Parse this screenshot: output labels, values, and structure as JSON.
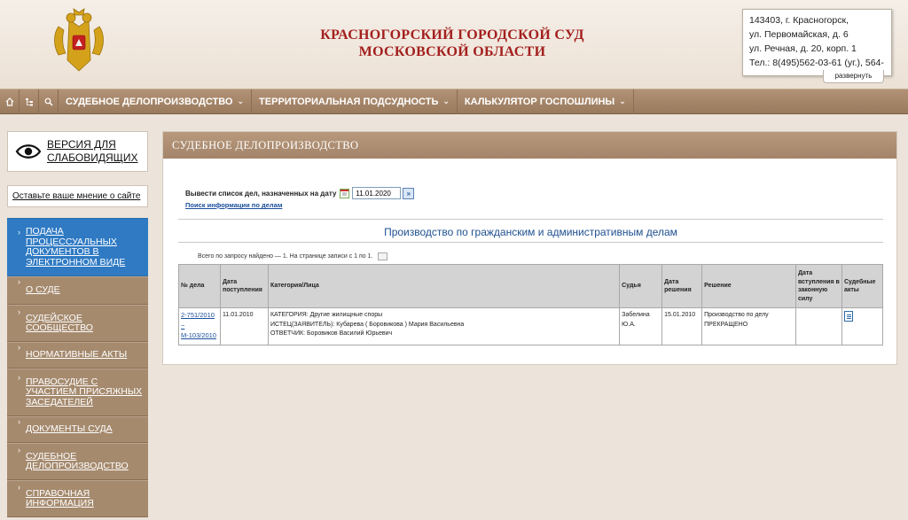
{
  "header": {
    "title_line1": "КРАСНОГОРСКИЙ ГОРОДСКОЙ СУД",
    "title_line2": "МОСКОВСКОЙ ОБЛАСТИ",
    "address": [
      "143403, г. Красногорск,",
      "ул. Первомайская, д. 6",
      "ул. Речная, д. 20, корп. 1",
      "Тел.: 8(495)562-03-61 (уг.), 564-"
    ],
    "expand_label": "развернуть"
  },
  "nav": {
    "icons": [
      "home-icon",
      "sitemap-icon",
      "search-icon"
    ],
    "items": [
      {
        "label": "СУДЕБНОЕ ДЕЛОПРОИЗВОДСТВО"
      },
      {
        "label": "ТЕРРИТОРИАЛЬНАЯ ПОДСУДНОСТЬ"
      },
      {
        "label": "КАЛЬКУЛЯТОР ГОСПОШЛИНЫ"
      }
    ],
    "chevron": "⌄"
  },
  "sidebar": {
    "vision_label": "ВЕРСИЯ ДЛЯ СЛАБОВИДЯЩИХ",
    "feedback_label": "Оставьте ваше мнение о сайте",
    "items": [
      {
        "label": "ПОДАЧА ПРОЦЕССУАЛЬНЫХ ДОКУМЕНТОВ В ЭЛЕКТРОННОМ ВИДЕ",
        "active": true
      },
      {
        "label": "О СУДЕ"
      },
      {
        "label": "СУДЕЙСКОЕ СООБЩЕСТВО"
      },
      {
        "label": "НОРМАТИВНЫЕ АКТЫ"
      },
      {
        "label": "ПРАВОСУДИЕ С УЧАСТИЕМ ПРИСЯЖНЫХ ЗАСЕДАТЕЛЕЙ"
      },
      {
        "label": "ДОКУМЕНТЫ СУДА"
      },
      {
        "label": "СУДЕБНОЕ ДЕЛОПРОИЗВОДСТВО"
      },
      {
        "label": "СПРАВОЧНАЯ ИНФОРМАЦИЯ"
      }
    ]
  },
  "main": {
    "panel_title": "СУДЕБНОЕ ДЕЛОПРОИЗВОДСТВО",
    "date_prompt": "Вывести список дел, назначенных на дату",
    "date_value": "11.01.2020",
    "go_label": "»",
    "search_link": "Поиск информации по делам",
    "section_title": "Производство по гражданским и административным делам",
    "found_text": "Всего по запросу найдено — 1. На странице записи с 1 по 1.",
    "table": {
      "headers": [
        "№ дела",
        "Дата поступления",
        "Категория/Лица",
        "Судья",
        "Дата решения",
        "Решение",
        "Дата вступления в законную силу",
        "Судебные акты"
      ],
      "rows": [
        {
          "case_no_1": "2-751/2010",
          "case_no_sep": "~",
          "case_no_2": "М-103/2010",
          "received": "11.01.2010",
          "category": "КАТЕГОРИЯ: Другие жилищные споры",
          "plaintiff": "ИСТЕЦ(ЗАЯВИТЕЛЬ): Кубарева ( Боровикова ) Мария Васильевна",
          "defendant": "ОТВЕТЧИК: Боровиков Василий Юрьевич",
          "judge": "Забелина Ю.А.",
          "decision_date": "15.01.2010",
          "decision": "Производство по делу ПРЕКРАЩЕНО",
          "effective_date": "",
          "acts_icon": "document-icon"
        }
      ]
    }
  }
}
